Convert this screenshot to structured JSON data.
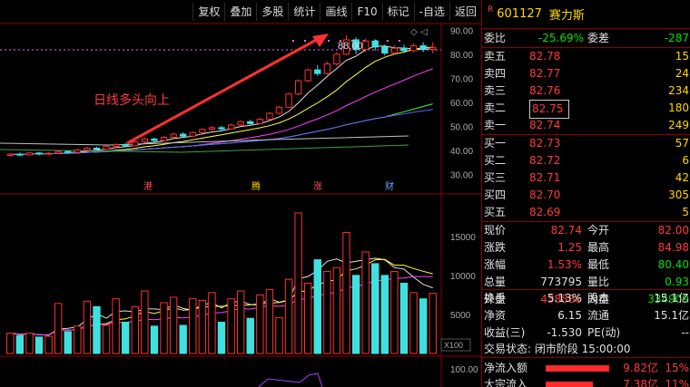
{
  "toolbar": [
    "复权",
    "叠加",
    "多股",
    "统计",
    "画线",
    "F10",
    "标记",
    "-自选",
    "返回"
  ],
  "stock": {
    "code": "601127",
    "name": "赛力斯"
  },
  "annotation": "日线多头向上",
  "peak_label": "88.00",
  "events": [
    "港",
    "腾",
    "涨",
    "财"
  ],
  "price_axis": [
    "90.00",
    "80.00",
    "70.00",
    "60.00",
    "50.00",
    "40.00",
    "30.00"
  ],
  "volume_axis": [
    "15000",
    "10000",
    "5000"
  ],
  "volume_unit": "X100",
  "bottom_axis": "100.00",
  "webi": {
    "label1": "委比",
    "val1": "-25.69%",
    "label2": "委差",
    "val2": "-287"
  },
  "asks": [
    {
      "label": "卖五",
      "price": "82.78",
      "vol": "15"
    },
    {
      "label": "卖四",
      "price": "82.77",
      "vol": "24"
    },
    {
      "label": "卖三",
      "price": "82.76",
      "vol": "234"
    },
    {
      "label": "卖二",
      "price": "82.75",
      "vol": "180"
    },
    {
      "label": "卖一",
      "price": "82.74",
      "vol": "249"
    }
  ],
  "bids": [
    {
      "label": "买一",
      "price": "82.73",
      "vol": "57"
    },
    {
      "label": "买二",
      "price": "82.72",
      "vol": "6"
    },
    {
      "label": "买三",
      "price": "82.71",
      "vol": "42"
    },
    {
      "label": "买四",
      "price": "82.70",
      "vol": "305"
    },
    {
      "label": "买五",
      "price": "82.69",
      "vol": "5"
    }
  ],
  "quote": [
    {
      "l1": "现价",
      "v1": "82.74",
      "l2": "今开",
      "v2": "82.00",
      "c1": "red",
      "c2": "red"
    },
    {
      "l1": "涨跌",
      "v1": "1.25",
      "l2": "最高",
      "v2": "84.98",
      "c1": "red",
      "c2": "red"
    },
    {
      "l1": "涨幅",
      "v1": "1.53%",
      "l2": "最低",
      "v2": "80.40",
      "c1": "red",
      "c2": "green"
    },
    {
      "l1": "总量",
      "v1": "773795",
      "l2": "量比",
      "v2": "0.93",
      "c1": "white",
      "c2": "green"
    },
    {
      "l1": "外盘",
      "v1": "438886",
      "l2": "内盘",
      "v2": "334909",
      "c1": "red",
      "c2": "green"
    }
  ],
  "stats": [
    {
      "l1": "换手",
      "v1": "5.13%",
      "l2": "股本",
      "v2": "15.1亿"
    },
    {
      "l1": "净资",
      "v1": "6.15",
      "l2": "流通",
      "v2": "15.1亿"
    },
    {
      "l1": "收益(三)",
      "v1": "-1.530",
      "l2": "PE(动)",
      "v2": "--"
    }
  ],
  "status": "交易状态: 闭市阶段 15:00:00",
  "flows": [
    {
      "label": "净流入额",
      "value": "9.82亿",
      "pct": "15%"
    },
    {
      "label": "大宗流入",
      "value": "7.38亿",
      "pct": "11%"
    }
  ],
  "chart_data": {
    "type": "candlestick",
    "price_ylim": [
      28,
      92
    ],
    "candles": [
      [
        38.0,
        38.5,
        37.5,
        39.0
      ],
      [
        38.5,
        38.2,
        37.6,
        39.2
      ],
      [
        38.2,
        39.0,
        37.9,
        39.5
      ],
      [
        39.0,
        38.6,
        38.0,
        39.4
      ],
      [
        38.6,
        38.9,
        38.1,
        39.3
      ],
      [
        38.9,
        39.6,
        38.5,
        40.1
      ],
      [
        39.6,
        39.3,
        38.8,
        40.0
      ],
      [
        39.3,
        40.2,
        39.0,
        40.8
      ],
      [
        40.2,
        41.0,
        39.8,
        41.6
      ],
      [
        41.0,
        40.6,
        40.0,
        41.5
      ],
      [
        40.6,
        41.8,
        40.3,
        42.3
      ],
      [
        41.8,
        42.5,
        41.2,
        43.0
      ],
      [
        42.5,
        42.0,
        41.4,
        43.1
      ],
      [
        42.0,
        43.6,
        41.8,
        44.2
      ],
      [
        43.6,
        44.8,
        43.0,
        45.3
      ],
      [
        44.8,
        44.2,
        43.6,
        45.4
      ],
      [
        44.2,
        45.5,
        43.8,
        46.0
      ],
      [
        45.5,
        46.8,
        45.0,
        47.5
      ],
      [
        46.8,
        46.0,
        45.5,
        47.6
      ],
      [
        46.0,
        47.5,
        45.7,
        48.0
      ],
      [
        47.5,
        48.8,
        47.0,
        49.3
      ],
      [
        48.8,
        49.5,
        48.3,
        50.2
      ],
      [
        49.5,
        49.0,
        48.4,
        50.3
      ],
      [
        49.0,
        50.6,
        48.8,
        51.2
      ],
      [
        50.6,
        52.0,
        50.2,
        52.6
      ],
      [
        52.0,
        51.2,
        50.8,
        52.8
      ],
      [
        51.2,
        53.0,
        51.0,
        53.6
      ],
      [
        53.0,
        55.5,
        52.6,
        56.0
      ],
      [
        55.5,
        58.0,
        55.0,
        58.6
      ],
      [
        58.0,
        63.5,
        57.6,
        64.0
      ],
      [
        63.5,
        69.0,
        63.0,
        69.6
      ],
      [
        69.0,
        73.5,
        68.4,
        74.0
      ],
      [
        73.5,
        72.0,
        71.0,
        75.5
      ],
      [
        72.0,
        76.0,
        71.5,
        77.0
      ],
      [
        76.0,
        80.0,
        75.2,
        81.0
      ],
      [
        80.0,
        86.0,
        79.5,
        88.0
      ],
      [
        86.0,
        82.0,
        80.0,
        87.0
      ],
      [
        82.0,
        85.5,
        81.0,
        86.5
      ],
      [
        85.5,
        83.0,
        81.5,
        86.2
      ],
      [
        83.0,
        80.5,
        79.5,
        84.0
      ],
      [
        80.5,
        82.5,
        80.0,
        83.6
      ],
      [
        82.5,
        81.5,
        80.5,
        84.0
      ],
      [
        81.5,
        83.5,
        80.8,
        84.5
      ],
      [
        83.5,
        82.0,
        80.9,
        85.0
      ],
      [
        82.0,
        82.74,
        80.4,
        84.98
      ]
    ],
    "volume_ylim": [
      0,
      19500
    ],
    "volumes": [
      2600,
      2300,
      2600,
      2100,
      2200,
      6400,
      2800,
      3500,
      6700,
      6000,
      3600,
      7000,
      4000,
      6000,
      8000,
      3500,
      6500,
      7200,
      3600,
      7000,
      6800,
      7800,
      4000,
      7000,
      8000,
      4500,
      7500,
      8200,
      4600,
      9500,
      18000,
      9000,
      12000,
      10500,
      11000,
      15500,
      10000,
      13000,
      11500,
      10000,
      10500,
      9000,
      7800,
      7000,
      7700
    ]
  }
}
